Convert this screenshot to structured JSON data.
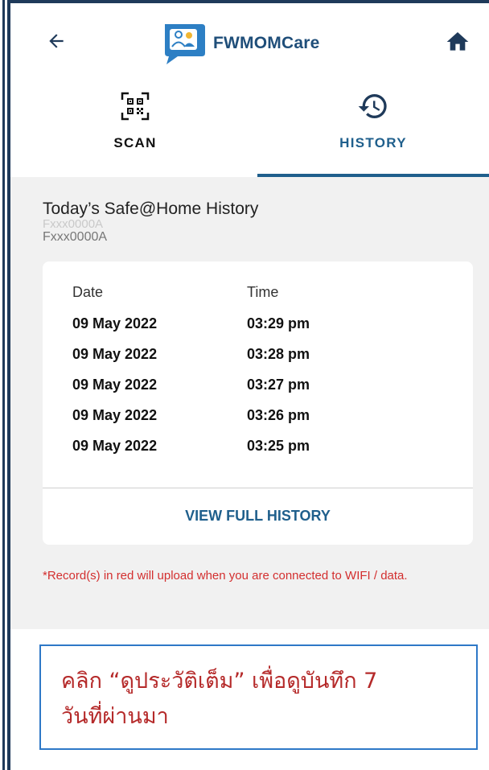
{
  "header": {
    "app_title": "FWMOMCare",
    "icons": {
      "back": "arrow-left-icon",
      "logo": "chat-people-logo-icon",
      "home": "home-icon"
    }
  },
  "tabs": [
    {
      "label": "SCAN",
      "icon": "qr-code-icon",
      "active": false
    },
    {
      "label": "HISTORY",
      "icon": "history-clock-icon",
      "active": true
    }
  ],
  "history": {
    "title": "Today’s Safe@Home History",
    "ghost_text": "Fxxx0000A",
    "worker_id": "Fxxx0000A",
    "columns": {
      "date": "Date",
      "time": "Time"
    },
    "rows": [
      {
        "date": "09 May 2022",
        "time": "03:29 pm"
      },
      {
        "date": "09 May 2022",
        "time": "03:28 pm"
      },
      {
        "date": "09 May 2022",
        "time": "03:27 pm"
      },
      {
        "date": "09 May 2022",
        "time": "03:26 pm"
      },
      {
        "date": "09 May 2022",
        "time": "03:25 pm"
      }
    ],
    "view_full_label": "VIEW FULL HISTORY",
    "note": "*Record(s) in red will upload when you are connected to WIFI / data."
  },
  "callout": {
    "line1": "คลิก “ดูประวัติเต็ม” เพื่อดูบันทึก 7",
    "line2": "วันที่ผ่านมา"
  },
  "colors": {
    "brand_dark": "#1f3a5a",
    "accent": "#1f5f8c",
    "note_red": "#d32f2f",
    "callout_red": "#b52a2a",
    "callout_border": "#2e78c7",
    "content_bg": "#f1f1f1"
  }
}
